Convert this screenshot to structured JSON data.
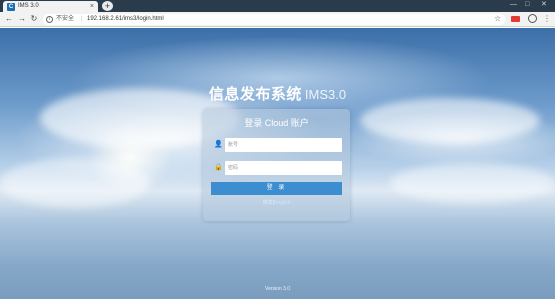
{
  "browser": {
    "tab_title": "IMS 3.0",
    "tab_favicon": "C",
    "new_tab_label": "+",
    "window_controls": {
      "minimize": "—",
      "maximize": "□",
      "close": "✕"
    },
    "security_label": "不安全",
    "url": "192.168.2.61/ims3/login.html",
    "icons": {
      "back": "arrow-left-icon",
      "forward": "arrow-right-icon",
      "reload": "reload-icon",
      "info": "info-icon",
      "star": "star-icon",
      "account": "account-icon",
      "menu": "more-vert-icon"
    }
  },
  "login": {
    "system_name": "信息发布系统",
    "version": "IMS3.0",
    "panel_title": "登录 Cloud 账户",
    "username_placeholder": "账号",
    "password_placeholder": "密码",
    "submit_label": "登 录",
    "lang_zh": "中文",
    "lang_sep": "|",
    "lang_en": "English"
  },
  "footer": {
    "text": "Version 3.0"
  },
  "colors": {
    "button": "#3d8ed1",
    "tabstrip": "#2a3b4c",
    "toolbar": "#f2f2f2"
  }
}
